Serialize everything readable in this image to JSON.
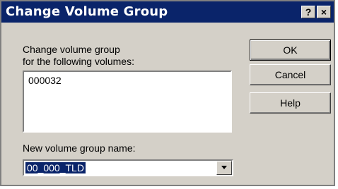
{
  "window": {
    "title": "Change Volume Group",
    "help_button": "?",
    "close_button": "×"
  },
  "form": {
    "prompt_line1": "Change volume group",
    "prompt_line2": "for the following volumes:",
    "volumes": [
      "000032"
    ],
    "new_name_label": "New volume group name:",
    "new_name_value": "00_000_TLD"
  },
  "buttons": {
    "ok": "OK",
    "cancel": "Cancel",
    "help": "Help"
  },
  "icons": {
    "help": "question-mark-icon",
    "close": "close-icon",
    "dropdown": "chevron-down-icon"
  },
  "colors": {
    "titlebar": "#0a246a",
    "dialog_bg": "#d4d0c8",
    "selection": "#0a246a"
  }
}
